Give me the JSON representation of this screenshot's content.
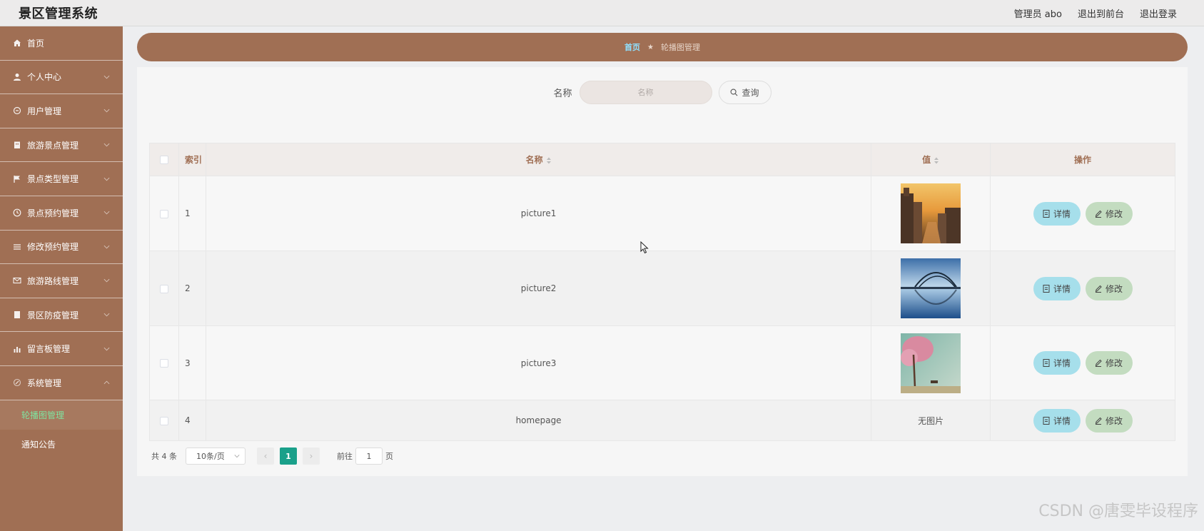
{
  "header": {
    "app_title": "景区管理系统",
    "user_label": "管理员 abo",
    "front_link": "退出到前台",
    "logout_link": "退出登录"
  },
  "sidebar": {
    "items": [
      {
        "label": "首页",
        "icon": "home-icon",
        "expandable": false
      },
      {
        "label": "个人中心",
        "icon": "user-icon",
        "expandable": true
      },
      {
        "label": "用户管理",
        "icon": "users-icon",
        "expandable": true
      },
      {
        "label": "旅游景点管理",
        "icon": "building-icon",
        "expandable": true
      },
      {
        "label": "景点类型管理",
        "icon": "flag-icon",
        "expandable": true
      },
      {
        "label": "景点预约管理",
        "icon": "clock-icon",
        "expandable": true
      },
      {
        "label": "修改预约管理",
        "icon": "list-icon",
        "expandable": true
      },
      {
        "label": "旅游路线管理",
        "icon": "mail-icon",
        "expandable": true
      },
      {
        "label": "景区防疫管理",
        "icon": "document-icon",
        "expandable": true
      },
      {
        "label": "留言板管理",
        "icon": "chart-icon",
        "expandable": true
      },
      {
        "label": "系统管理",
        "icon": "gear-icon",
        "expandable": true
      }
    ],
    "subitems": [
      {
        "label": "轮播图管理",
        "active": true
      },
      {
        "label": "通知公告",
        "active": false
      }
    ]
  },
  "breadcrumb": {
    "home": "首页",
    "separator": "★",
    "current": "轮播图管理"
  },
  "search": {
    "label": "名称",
    "placeholder": "名称",
    "button_label": "查询"
  },
  "table": {
    "columns": {
      "index": "索引",
      "name": "名称",
      "value": "值",
      "actions": "操作"
    },
    "rows": [
      {
        "index": "1",
        "name": "picture1",
        "value_image": "sunset-canal-image",
        "value_text": ""
      },
      {
        "index": "2",
        "name": "picture2",
        "value_image": "bridge-lake-image",
        "value_text": ""
      },
      {
        "index": "3",
        "name": "picture3",
        "value_image": "pink-tree-image",
        "value_text": ""
      },
      {
        "index": "4",
        "name": "homepage",
        "value_image": "",
        "value_text": "无图片"
      }
    ],
    "detail_label": "详情",
    "edit_label": "修改"
  },
  "pagination": {
    "total": "共 4 条",
    "page_size": "10条/页",
    "current_page": "1",
    "goto_prefix": "前往",
    "goto_value": "1",
    "goto_suffix": "页"
  },
  "watermark": "CSDN @唐雯毕设程序",
  "colors": {
    "sidebar": "#a06f54",
    "detail_button": "#a6dfeb",
    "edit_button": "#c3dcc0",
    "active_page": "#1aa08a"
  }
}
